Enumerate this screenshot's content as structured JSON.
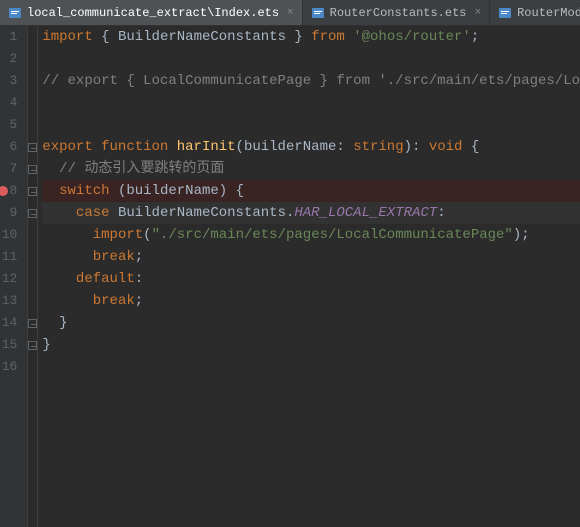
{
  "tabs": [
    {
      "label": "local_communicate_extract\\Index.ets",
      "active": true
    },
    {
      "label": "RouterConstants.ets",
      "active": false
    },
    {
      "label": "RouterModule.ets",
      "active": false
    }
  ],
  "gutter": {
    "lines": [
      "1",
      "2",
      "3",
      "4",
      "5",
      "6",
      "7",
      "8",
      "9",
      "10",
      "11",
      "12",
      "13",
      "14",
      "15",
      "16"
    ],
    "breakpointAt": 8,
    "currentLine": 9,
    "foldAt": [
      6,
      7,
      8,
      9,
      14,
      15
    ]
  },
  "code": {
    "l1": {
      "kw1": "import",
      "p1": " { ",
      "id1": "BuilderNameConstants",
      "p2": " } ",
      "kw2": "from",
      "p3": " ",
      "str1": "'@ohos/router'",
      "p4": ";"
    },
    "l3": {
      "cmt": "// export { LocalCommunicatePage } from './src/main/ets/pages/Lo"
    },
    "l6": {
      "kw1": "export function ",
      "fn": "harInit",
      "p1": "(",
      "param": "builderName",
      "p2": ": ",
      "type": "string",
      "p3": "): ",
      "ret": "void",
      "p4": " {"
    },
    "l7": {
      "indent": "  ",
      "cmt": "// 动态引入要跳转的页面"
    },
    "l8": {
      "indent": "  ",
      "kw": "switch",
      "p1": " (",
      "id": "builderName",
      "p2": ") {"
    },
    "l9": {
      "indent": "    ",
      "kw": "case",
      "p1": " ",
      "id": "BuilderNameConstants",
      "p2": ".",
      "prop": "HAR_LOCAL_EXTRACT",
      "p3": ":"
    },
    "l10": {
      "indent": "      ",
      "kw": "import",
      "p1": "(",
      "str": "\"./src/main/ets/pages/LocalCommunicatePage\"",
      "p2": ");"
    },
    "l11": {
      "indent": "      ",
      "kw": "break",
      "p1": ";"
    },
    "l12": {
      "indent": "    ",
      "kw": "default",
      "p1": ":"
    },
    "l13": {
      "indent": "      ",
      "kw": "break",
      "p1": ";"
    },
    "l14": {
      "indent": "  ",
      "p1": "}"
    },
    "l15": {
      "p1": "}"
    }
  }
}
